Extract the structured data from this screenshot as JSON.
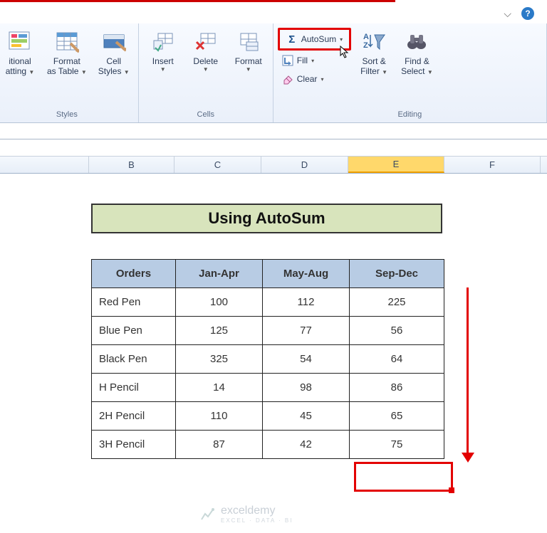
{
  "titlebar": {
    "help": "?"
  },
  "ribbon": {
    "groups": {
      "styles": {
        "label": "Styles",
        "cond_fmt_l1": "itional",
        "cond_fmt_l2": "atting",
        "format_table_l1": "Format",
        "format_table_l2": "as Table",
        "cell_styles_l1": "Cell",
        "cell_styles_l2": "Styles"
      },
      "cells": {
        "label": "Cells",
        "insert": "Insert",
        "delete": "Delete",
        "format": "Format"
      },
      "editing": {
        "label": "Editing",
        "autosum": "AutoSum",
        "fill": "Fill",
        "clear": "Clear",
        "sort_l1": "Sort &",
        "sort_l2": "Filter",
        "find_l1": "Find &",
        "find_l2": "Select"
      }
    }
  },
  "columns": [
    "",
    "B",
    "C",
    "D",
    "E",
    "F"
  ],
  "selected_column_index": 4,
  "title_cell": "Using AutoSum",
  "table": {
    "headers": [
      "Orders",
      "Jan-Apr",
      "May-Aug",
      "Sep-Dec"
    ],
    "rows": [
      [
        "Red Pen",
        "100",
        "112",
        "225"
      ],
      [
        "Blue Pen",
        "125",
        "77",
        "56"
      ],
      [
        "Black Pen",
        "325",
        "54",
        "64"
      ],
      [
        "H Pencil",
        "14",
        "98",
        "86"
      ],
      [
        "2H Pencil",
        "110",
        "45",
        "65"
      ],
      [
        "3H Pencil",
        "87",
        "42",
        "75"
      ]
    ]
  },
  "watermark": {
    "brand": "exceldemy",
    "sub": "EXCEL · DATA · BI"
  },
  "chart_data": {
    "type": "table",
    "title": "Using AutoSum",
    "categories": [
      "Jan-Apr",
      "May-Aug",
      "Sep-Dec"
    ],
    "series": [
      {
        "name": "Red Pen",
        "values": [
          100,
          112,
          225
        ]
      },
      {
        "name": "Blue Pen",
        "values": [
          125,
          77,
          56
        ]
      },
      {
        "name": "Black Pen",
        "values": [
          325,
          54,
          64
        ]
      },
      {
        "name": "H Pencil",
        "values": [
          14,
          98,
          86
        ]
      },
      {
        "name": "2H Pencil",
        "values": [
          110,
          45,
          65
        ]
      },
      {
        "name": "3H Pencil",
        "values": [
          87,
          42,
          75
        ]
      }
    ]
  }
}
